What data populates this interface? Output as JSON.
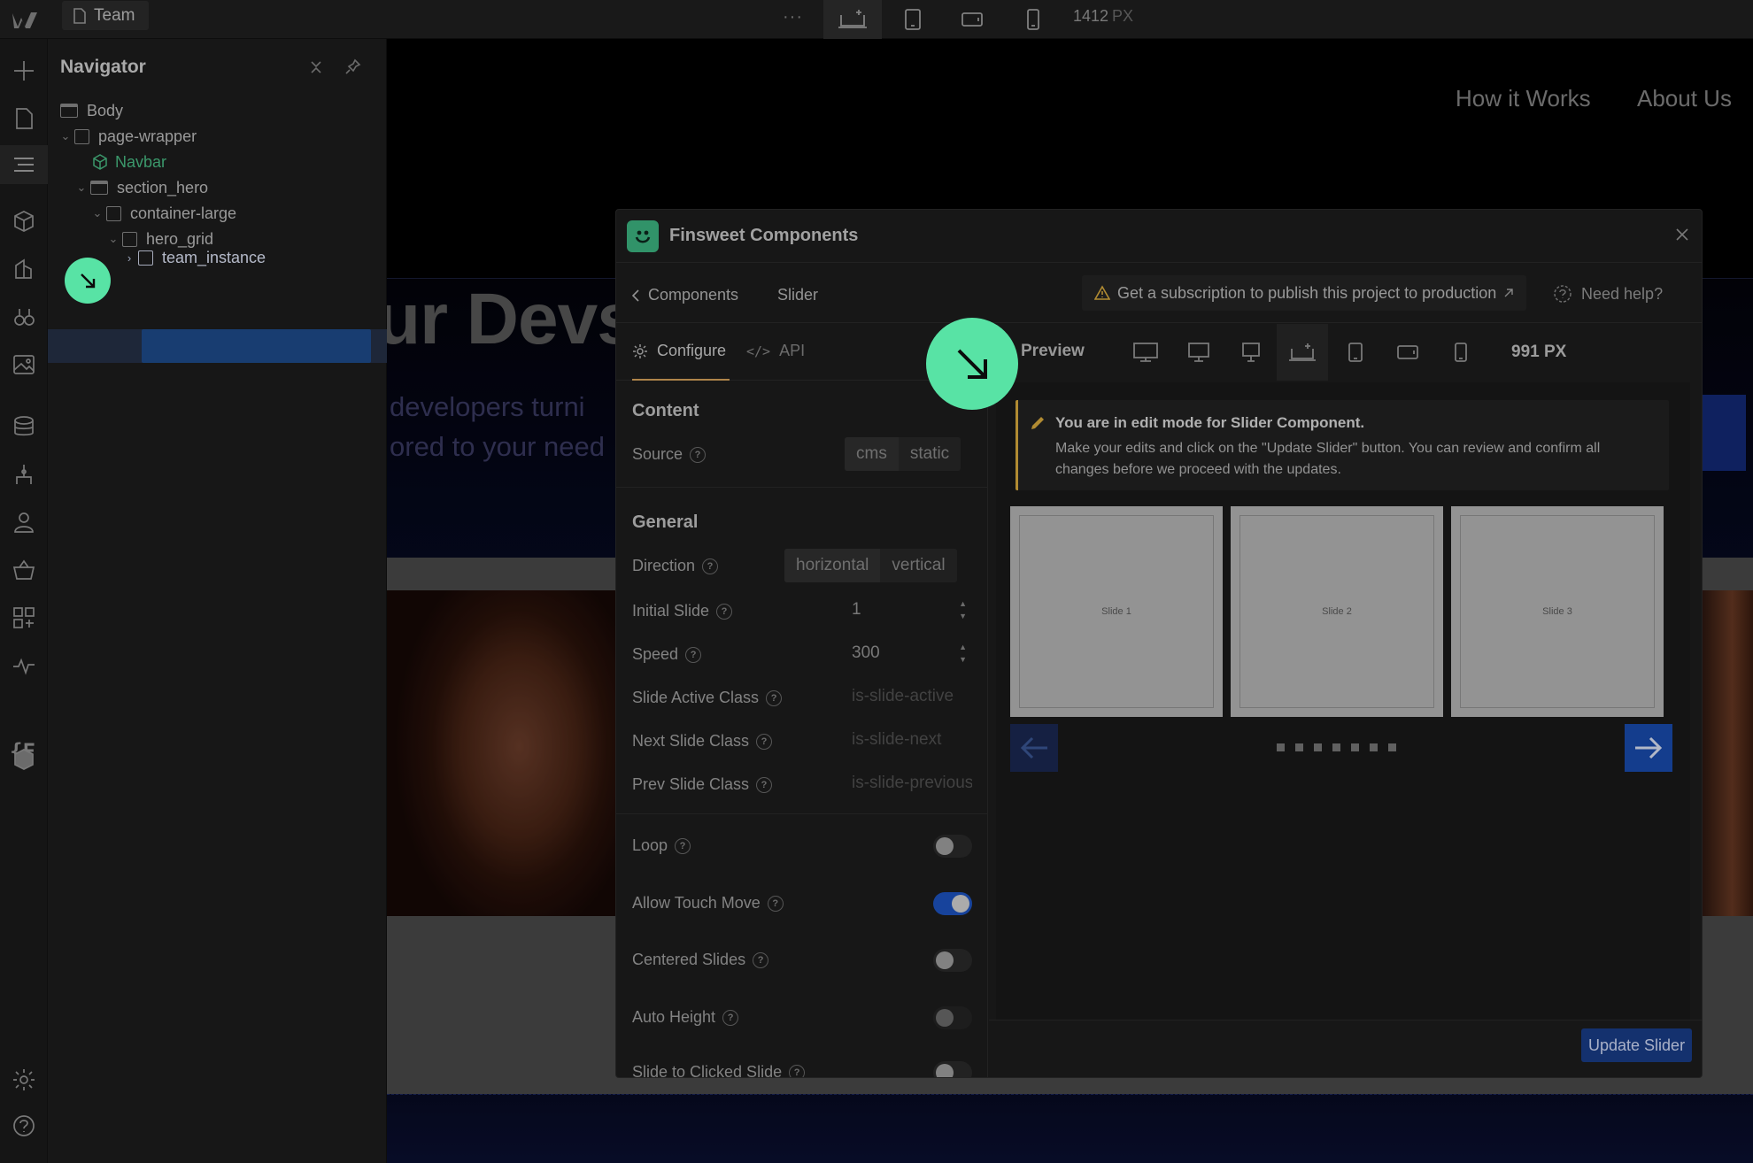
{
  "topbar": {
    "page_tab": "Team",
    "more": "···",
    "breakpoint_px": "1412",
    "breakpoint_unit": "PX"
  },
  "navigator": {
    "title": "Navigator",
    "tree": [
      {
        "label": "Body"
      },
      {
        "label": "page-wrapper"
      },
      {
        "label": "Navbar"
      },
      {
        "label": "section_hero"
      },
      {
        "label": "container-large"
      },
      {
        "label": "hero_grid"
      },
      {
        "label": "team_instance"
      }
    ]
  },
  "canvas": {
    "nav_links": [
      "How it Works",
      "About Us"
    ],
    "hero_title": "ur Devs",
    "hero_sub_1": "developers turni",
    "hero_sub_2": "ored to your need"
  },
  "modal": {
    "title": "Finsweet Components",
    "crumb_back": "Components",
    "crumb_current": "Slider",
    "subscription_banner": "Get a subscription to publish this project to production",
    "need_help": "Need help?",
    "tabs": {
      "configure": "Configure",
      "api": "API"
    },
    "content_section": "Content",
    "source": {
      "label": "Source",
      "options": [
        "cms",
        "static"
      ]
    },
    "general_section": "General",
    "direction": {
      "label": "Direction",
      "options": [
        "horizontal",
        "vertical"
      ]
    },
    "initial_slide": {
      "label": "Initial Slide",
      "value": "1"
    },
    "speed": {
      "label": "Speed",
      "value": "300"
    },
    "slide_active_class": {
      "label": "Slide Active Class",
      "placeholder": "is-slide-active"
    },
    "next_slide_class": {
      "label": "Next Slide Class",
      "placeholder": "is-slide-next"
    },
    "prev_slide_class": {
      "label": "Prev Slide Class",
      "placeholder": "is-slide-previous"
    },
    "loop": {
      "label": "Loop",
      "on": false
    },
    "allow_touch_move": {
      "label": "Allow Touch Move",
      "on": true
    },
    "centered_slides": {
      "label": "Centered Slides",
      "on": false
    },
    "auto_height": {
      "label": "Auto Height",
      "on": false
    },
    "slide_to_clicked": {
      "label": "Slide to Clicked Slide",
      "on": false
    },
    "preview": {
      "label": "Preview",
      "px": "991 PX",
      "notice_title": "You are in edit mode for Slider Component.",
      "notice_body": "Make your edits and click on the \"Update Slider\" button. You can review and confirm all changes before we proceed with the updates.",
      "slides": [
        "Slide 1",
        "Slide 2",
        "Slide 3"
      ],
      "dot_count": 7
    },
    "update_button": "Update Slider"
  },
  "colors": {
    "accent_green": "#58e3a5",
    "selection_blue": "#1f4f91",
    "notice_yellow": "#e3b341",
    "toggle_on": "#1e57c8"
  }
}
